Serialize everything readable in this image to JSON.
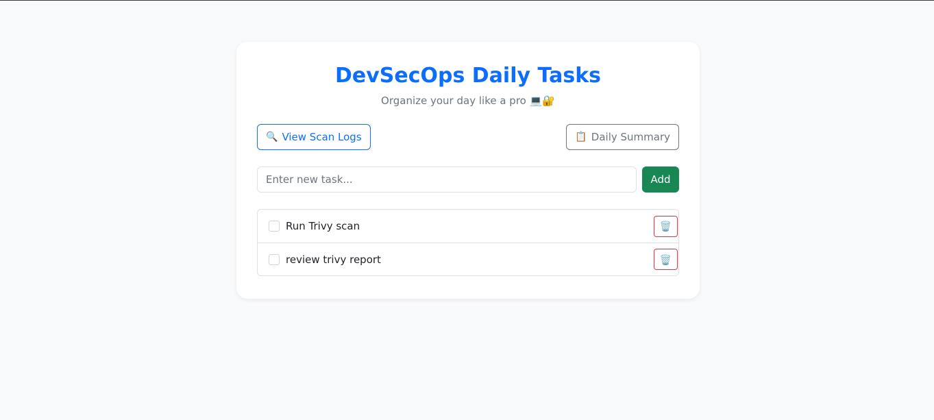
{
  "header": {
    "title": "DevSecOps Daily Tasks",
    "subtitle": "Organize your day like a pro 💻🔐"
  },
  "toolbar": {
    "scan_logs_icon": "🔍",
    "scan_logs_label": "View Scan Logs",
    "summary_icon": "📋",
    "summary_label": "Daily Summary"
  },
  "new_task": {
    "placeholder": "Enter new task...",
    "value": "",
    "add_label": "Add"
  },
  "tasks": [
    {
      "text": "Run Trivy scan",
      "done": false,
      "delete_icon": "🗑️"
    },
    {
      "text": "review trivy report",
      "done": false,
      "delete_icon": "🗑️"
    }
  ],
  "colors": {
    "primary": "#0d6efd",
    "success": "#198754",
    "danger": "#dc3545",
    "secondary": "#6c757d"
  }
}
